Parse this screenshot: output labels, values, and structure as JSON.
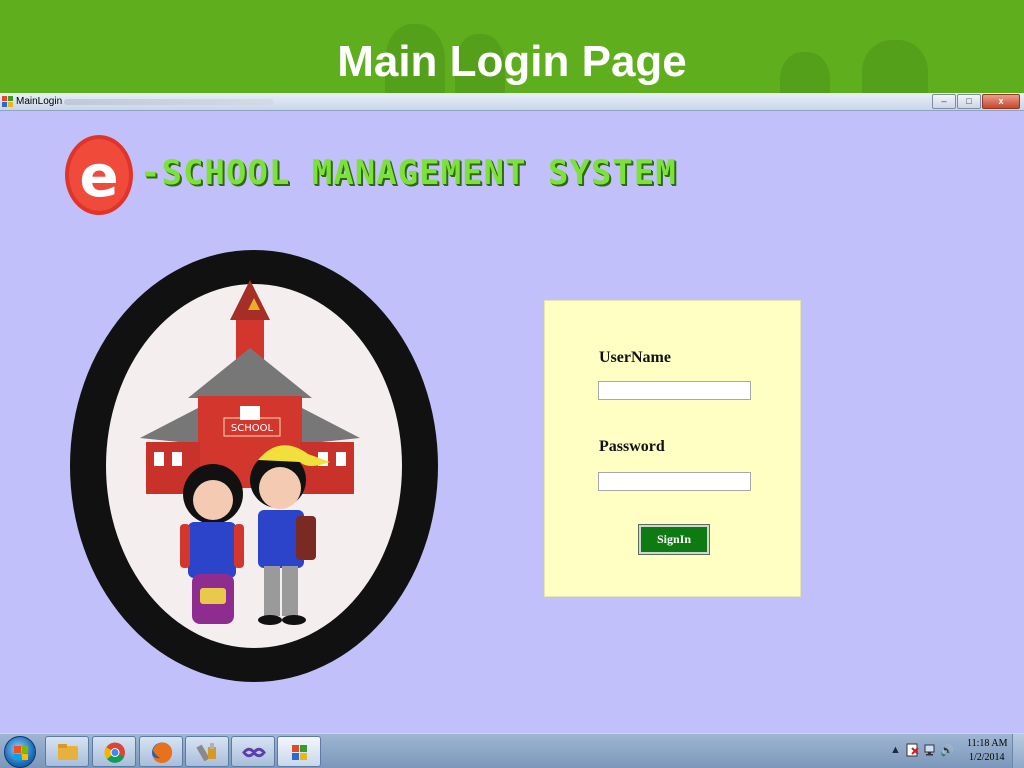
{
  "slide": {
    "title": "Main Login Page"
  },
  "window": {
    "title": "MainLogin",
    "buttons": {
      "minimize": "–",
      "maximize": "□",
      "close": "x"
    }
  },
  "app": {
    "logo_letter": "e",
    "logo_text": "-SCHOOL MANAGEMENT SYSTEM",
    "illustration_sign": "SCHOOL"
  },
  "login": {
    "username_label": "UserName",
    "username_value": "",
    "password_label": "Password",
    "password_value": "",
    "signin_label": "SignIn"
  },
  "taskbar": {
    "pinned": [
      "folder-icon",
      "chrome-icon",
      "firefox-icon",
      "tools-icon",
      "visual-studio-icon",
      "windows-form-icon"
    ],
    "tray": {
      "arrow": "▲",
      "volume": "🔊"
    },
    "clock_time": "11:18 AM",
    "clock_date": "1/2/2014"
  },
  "colors": {
    "banner": "#5fae1e",
    "background": "#c2c0fb",
    "panel": "#ffffc4",
    "signin": "#0e7a12",
    "logo_green": "#7ce23a",
    "logo_red": "#e0342a"
  }
}
